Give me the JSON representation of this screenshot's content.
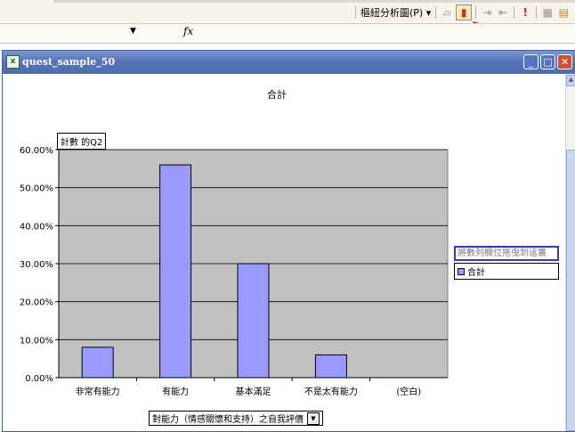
{
  "toolbar": {
    "pivot_label": "樞紐分析圖(P) ▾",
    "formula_fx": "fx"
  },
  "window": {
    "title": "quest_sample_50"
  },
  "chart_data": {
    "type": "bar",
    "title": "合計",
    "series_field": "計數 的Q2",
    "category_field": "對能力（情感關懷和支持）之自我評價",
    "categories": [
      "非常有能力",
      "有能力",
      "基本滿足",
      "不是太有能力",
      "(空白)"
    ],
    "series": [
      {
        "name": "合計",
        "values": [
          0.08,
          0.56,
          0.3,
          0.06,
          0
        ]
      }
    ],
    "yticks": [
      "0.00%",
      "10.00%",
      "20.00%",
      "30.00%",
      "40.00%",
      "50.00%",
      "60.00%"
    ],
    "ylim": [
      0,
      0.6
    ],
    "grid": true,
    "legend_position": "right",
    "drop_zone_text": "將數列欄位拖曳到這裏",
    "colors": {
      "bar": "#9999ff",
      "plot_bg": "#c0c0c0"
    }
  }
}
